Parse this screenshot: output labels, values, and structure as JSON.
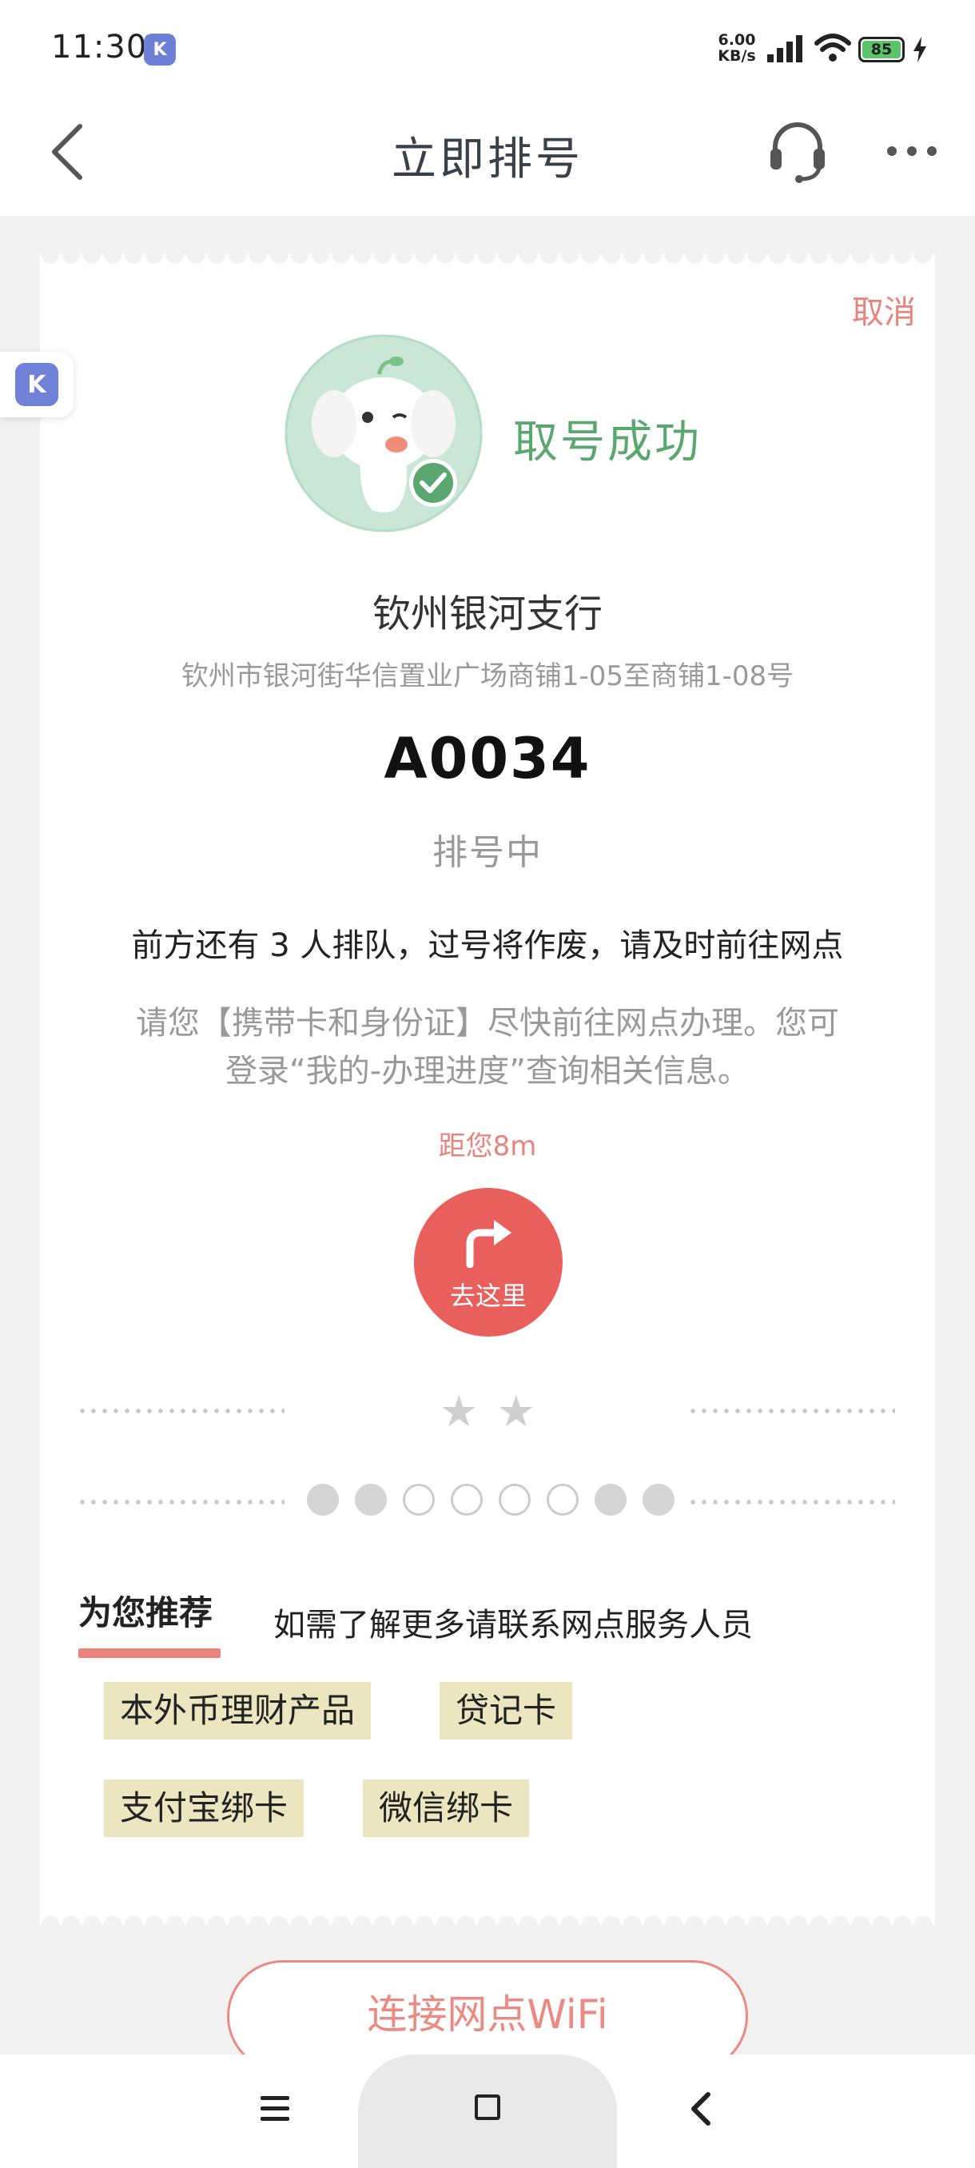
{
  "status_bar": {
    "time": "11:30",
    "app_icon_letter": "K",
    "net_speed": "6.00\nKB/s",
    "net_speed_value": "6.00",
    "net_speed_unit": "KB/s",
    "battery": "85",
    "battery_color": "#5bc46a"
  },
  "header": {
    "title": "立即排号",
    "back_icon": "chevron-left-icon",
    "service_icon": "headset-icon",
    "more_icon": "more-dots-icon"
  },
  "ticket": {
    "cancel_label": "取消",
    "success_text": "取号成功",
    "branch_name": "钦州银河支行",
    "branch_address": "钦州市银河街华信置业广场商铺1-05至商铺1-08号",
    "number": "A0034",
    "status": "排号中",
    "queue_info": "前方还有 3 人排队，过号将作废，请及时前往网点",
    "reminder": "请您【携带卡和身份证】尽快前往网点办理。您可登录“我的-办理进度”查询相关信息。",
    "reminder_line1": "请您【携带卡和身份证】尽快前往网点办理。您可",
    "reminder_line2": "登录“我的-办理进度”查询相关信息。",
    "distance": "距您8m",
    "goto_label": "去这里",
    "stars": [
      "★",
      "★"
    ],
    "progress_dots": [
      true,
      true,
      false,
      false,
      false,
      false,
      true,
      true
    ]
  },
  "recommend": {
    "title": "为您推荐",
    "hint": "如需了解更多请联系网点服务人员",
    "tags": [
      "本外币理财产品",
      "贷记卡",
      "支付宝绑卡",
      "微信绑卡"
    ]
  },
  "wifi_button": "连接网点WiFi",
  "float_icon_letter": "K",
  "colors": {
    "accent": "#e95f5c",
    "success": "#5aa870",
    "link": "#e8847b",
    "tag_bg": "#ebe6bf"
  }
}
